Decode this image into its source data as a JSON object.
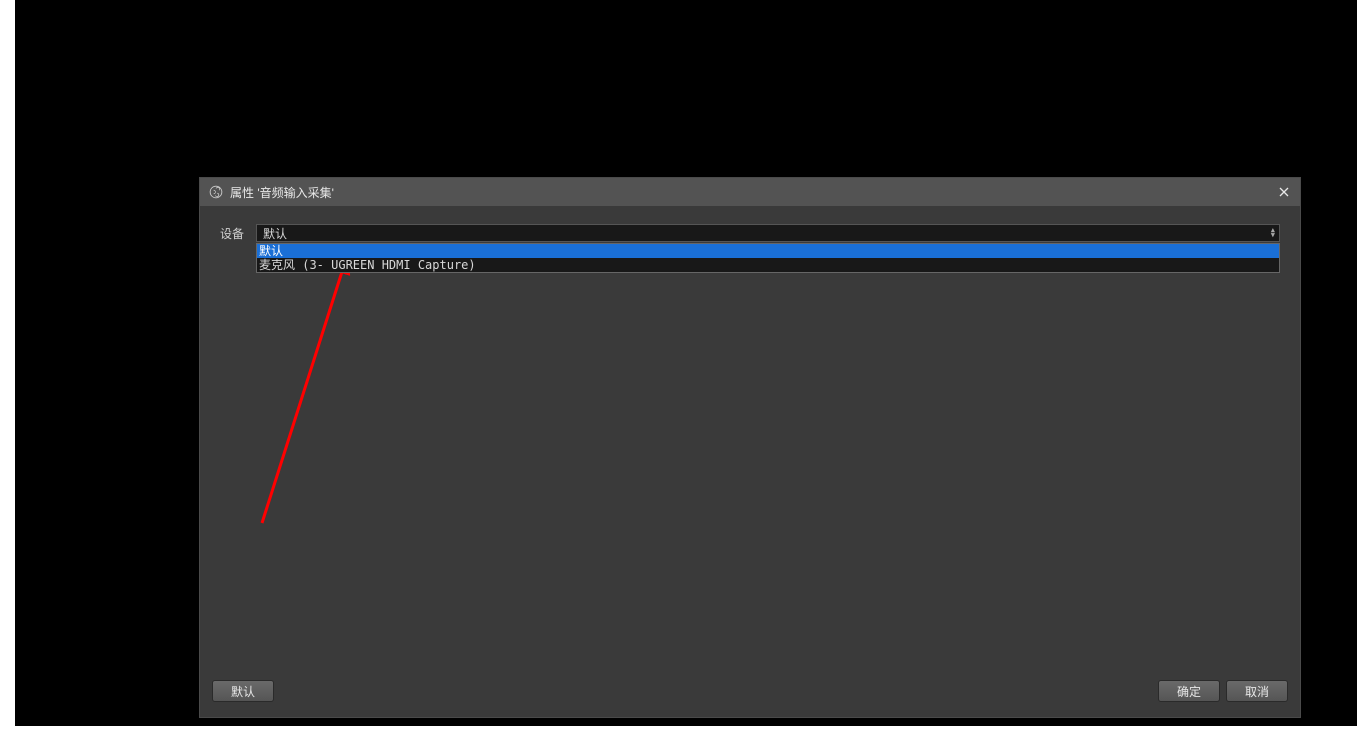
{
  "dialog": {
    "title": "属性 '音频输入采集'",
    "field_label": "设备",
    "selected_value": "默认",
    "options": [
      {
        "label": "默认",
        "selected": true
      },
      {
        "label": "麦克风 (3- UGREEN HDMI Capture)",
        "selected": false
      }
    ],
    "buttons": {
      "defaults": "默认",
      "ok": "确定",
      "cancel": "取消"
    }
  }
}
